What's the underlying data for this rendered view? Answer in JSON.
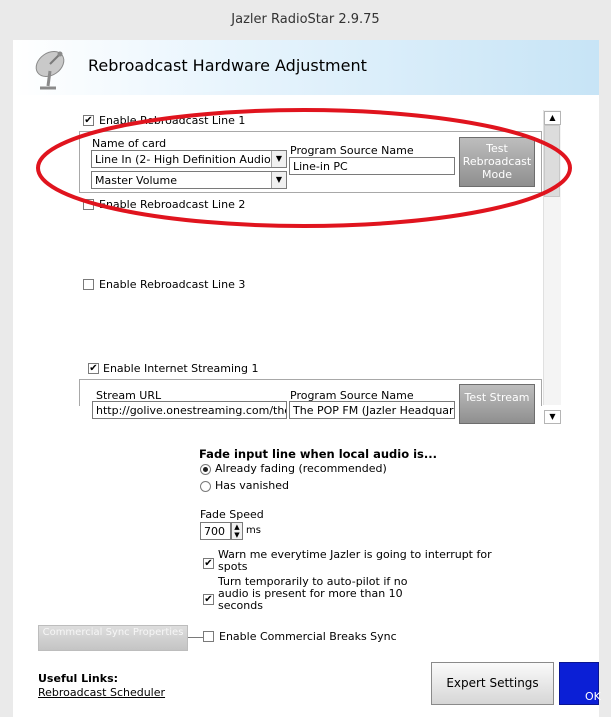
{
  "window": {
    "title": "Jazler RadioStar 2.9.75"
  },
  "header": {
    "title": "Rebroadcast Hardware Adjustment",
    "icon": "satellite-dish-icon"
  },
  "line1": {
    "enable_label": "Enable Rebroadcast Line 1",
    "checked": "✔",
    "name_of_card_label": "Name of card",
    "card_value": "Line In (2- High Definition Audio",
    "volume_value": "Master Volume",
    "program_source_label": "Program Source Name",
    "program_source_value": "Line-in PC",
    "test_button": "Test Rebroadcast Mode"
  },
  "line2": {
    "enable_label": "Enable Rebroadcast Line 2"
  },
  "line3": {
    "enable_label": "Enable Rebroadcast Line 3"
  },
  "stream1": {
    "enable_label": "Enable Internet Streaming 1",
    "checked": "✔",
    "url_label": "Stream URL",
    "url_value": "http://golive.onestreaming.com/the",
    "program_source_label": "Program Source Name",
    "program_source_value": "The POP FM (Jazler Headquar",
    "test_button": "Test Stream"
  },
  "fade": {
    "heading": "Fade input line when local audio is...",
    "option_fading": "Already fading (recommended)",
    "option_vanished": "Has vanished",
    "speed_label": "Fade Speed",
    "speed_value": "700",
    "speed_unit": "ms"
  },
  "options": {
    "warn_label": "Warn me everytime Jazler is going to interrupt for spots",
    "warn_checked": "✔",
    "autopilot_label": "Turn temporarily to auto-pilot if no audio is present for more than 10 seconds",
    "autopilot_checked": "✔"
  },
  "commercial": {
    "sync_button": "Commercial Sync Properties",
    "breaks_label": "Enable Commercial Breaks Sync"
  },
  "links": {
    "heading": "Useful Links:",
    "scheduler": "Rebroadcast Scheduler"
  },
  "footer": {
    "expert_button": "Expert Settings",
    "ok_button": "OK"
  },
  "colors": {
    "highlight_ellipse": "#e0141e",
    "ok_blue": "#0b1fd6",
    "header_blue": "#c7e4f6"
  }
}
